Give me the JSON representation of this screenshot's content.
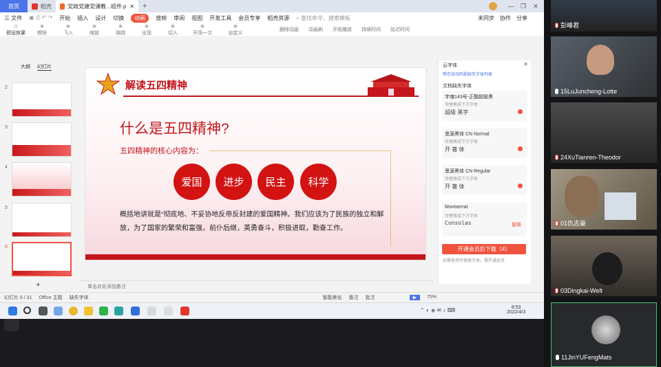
{
  "titlebar": {
    "home_tab": "首页",
    "tab1": "稻壳",
    "tab2": "党政党建党课教...组件.ppt编辑",
    "new_tab": "+",
    "win_controls": [
      "—",
      "❐",
      "✕"
    ]
  },
  "menu": {
    "file": "三 文件",
    "items": [
      "开始",
      "插入",
      "设计",
      "切换",
      "动画",
      "放映",
      "审阅",
      "视图",
      "开发工具",
      "会员专享",
      "稻壳资源"
    ],
    "active": "动画",
    "search": "查找命令、搜索模板",
    "right": [
      "未同步",
      "协作",
      "分享"
    ]
  },
  "toolbar": {
    "items": [
      "预设效果",
      "擦除",
      "飞入",
      "缩放",
      "弹跳",
      "出现",
      "切入",
      "开场一次",
      "自定义"
    ],
    "right_items": [
      "删除动画",
      "动画刷",
      "开始播放",
      "持续时间",
      "延迟时间"
    ]
  },
  "leftpanel": {
    "tabs": [
      "大纲",
      "幻灯片"
    ],
    "slides": [
      {
        "num": "2",
        "label": ""
      },
      {
        "num": "3",
        "label": ""
      },
      {
        "num": "4",
        "label": ""
      },
      {
        "num": "5",
        "label": ""
      },
      {
        "num": "6",
        "label": ""
      }
    ],
    "add": "+"
  },
  "slide": {
    "header_title": "解读五四精神",
    "question": "什么是五四精神?",
    "core": "五四精神的核心内容为：",
    "circles": [
      "爱国",
      "进步",
      "民主",
      "科学"
    ],
    "paragraph": "概括地讲就是“彻底地、不妥协地反帝反封建的爱国精神。我们应该为了民族的独立和解放，为了国家的繁荣和富强，前仆后继，英勇奋斗，积极进取，勤奋工作。"
  },
  "notes": "单击此处添加备注",
  "rightpanel": {
    "title": "云字体",
    "link": "帮您自动匹配缺失字体列表",
    "section": "文档缺失字体",
    "fonts": [
      {
        "name": "字魂143号-正酷超级黑",
        "sub": "待替换成下方字体",
        "sample": "超级 黑字"
      },
      {
        "name": "思源黑体 CN Normal",
        "sub": "待替换成下方字体",
        "sample": "开 箸 体"
      },
      {
        "name": "思源黑体 CN Regular",
        "sub": "待替换成下方字体",
        "sample": "开 箸 体"
      },
      {
        "name": "Montserrat",
        "sub": "待替换成下方字体",
        "sample": "Consolas",
        "action": "替换"
      }
    ],
    "download_button": "开通会员后下载（4）",
    "note": "如需使用可搜索字体，需开通会员"
  },
  "statusbar": {
    "slide_info": "幻灯片 6 / 31",
    "theme": "Office 主题",
    "font_missing": "缺失字体",
    "beautify": "智能美化",
    "notes_btn": "备注",
    "comment": "批注",
    "zoom": "75%"
  },
  "taskbar": {
    "time": "8:53",
    "date": "2022/4/3"
  },
  "participants": [
    {
      "name": "彭峰君"
    },
    {
      "name": "15LuJuncheng-Lotte"
    },
    {
      "name": "24XuTianren-Theodor"
    },
    {
      "name": "01仇志豪"
    },
    {
      "name": "03Dingkai-Welt"
    },
    {
      "name": "11JinYUFengMats"
    }
  ],
  "colors": {
    "accent": "#f0533f",
    "party_red": "#c4161c",
    "circle_red": "#d31212"
  }
}
